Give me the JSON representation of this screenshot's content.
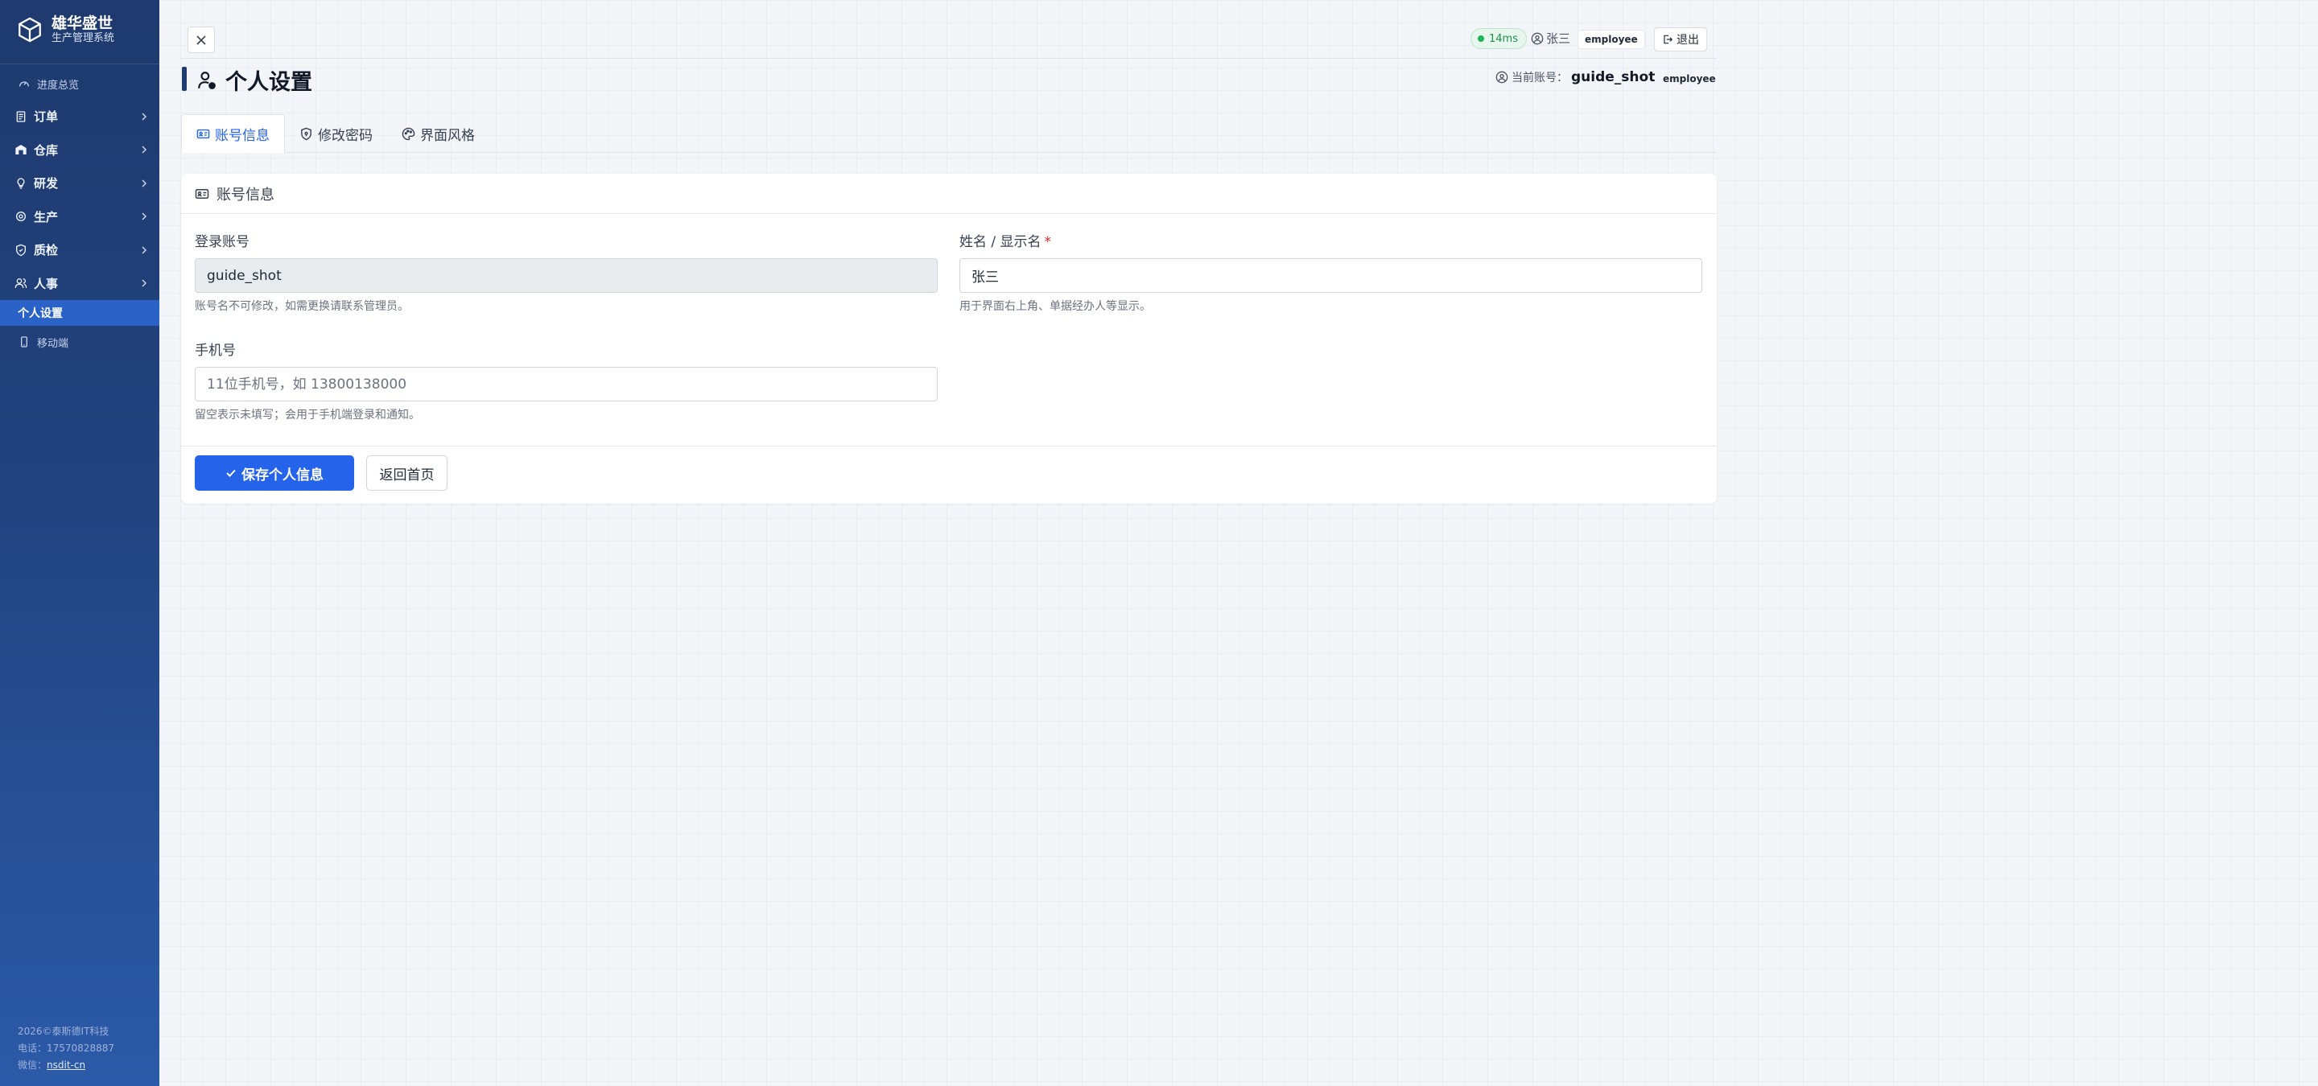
{
  "sidebar": {
    "brand_title": "雄华盛世",
    "brand_subtitle": "生产管理系统",
    "top_item": "进度总览",
    "items": [
      {
        "label": "订单",
        "icon": "receipt-icon"
      },
      {
        "label": "仓库",
        "icon": "warehouse-icon"
      },
      {
        "label": "研发",
        "icon": "lightbulb-icon"
      },
      {
        "label": "生产",
        "icon": "gear-icon"
      },
      {
        "label": "质检",
        "icon": "shield-icon"
      },
      {
        "label": "人事",
        "icon": "people-icon"
      }
    ],
    "active_item": "个人设置",
    "mobile_item": "移动端",
    "footer": {
      "copyright": "2026©泰斯德IT科技",
      "phone": "电话：17570828887",
      "wechat_label": "微信：",
      "wechat_value": "nsdit-cn"
    }
  },
  "topbar": {
    "latency": "14ms",
    "user_name": "张三",
    "role": "employee",
    "logout_label": "退出"
  },
  "page": {
    "title": "个人设置",
    "current_account_label": "当前账号：",
    "current_account": "guide_shot",
    "current_role": "employee"
  },
  "tabs": [
    {
      "label": "账号信息",
      "active": true
    },
    {
      "label": "修改密码",
      "active": false
    },
    {
      "label": "界面风格",
      "active": false
    }
  ],
  "card": {
    "header": "账号信息",
    "login_account": {
      "label": "登录账号",
      "value": "guide_shot",
      "hint": "账号名不可修改，如需更换请联系管理员。"
    },
    "display_name": {
      "label": "姓名 / 显示名",
      "required_mark": "*",
      "value": "张三",
      "hint": "用于界面右上角、单据经办人等显示。"
    },
    "phone": {
      "label": "手机号",
      "placeholder": "11位手机号，如 13800138000",
      "value": "",
      "hint": "留空表示未填写；会用于手机端登录和通知。"
    },
    "save_label": "保存个人信息",
    "back_label": "返回首页"
  },
  "colors": {
    "sidebar_top": "#1e3a6e",
    "sidebar_bottom": "#2b5aa8",
    "accent": "#2563eb",
    "latency_ok": "#22b45a"
  }
}
